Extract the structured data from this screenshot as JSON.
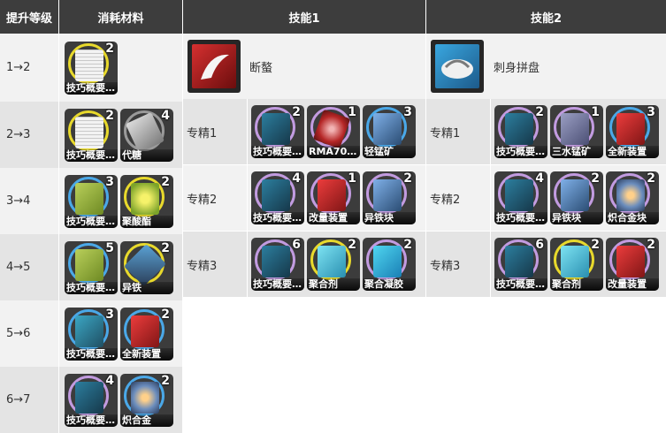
{
  "headers": {
    "level": "提升等级",
    "materials": "消耗材料",
    "skill1": "技能1",
    "skill2": "技能2"
  },
  "upgrade_rows": [
    {
      "level": "1→2",
      "items": [
        {
          "name": "技巧概要…",
          "count": "2",
          "ring": "yellow",
          "art": "paper"
        }
      ]
    },
    {
      "level": "2→3",
      "items": [
        {
          "name": "技巧概要…",
          "count": "2",
          "ring": "yellow",
          "art": "paper"
        },
        {
          "name": "代糖",
          "count": "4",
          "ring": "gray",
          "art": "bar"
        }
      ]
    },
    {
      "level": "3→4",
      "items": [
        {
          "name": "技巧概要…",
          "count": "3",
          "ring": "blue",
          "art": "green"
        },
        {
          "name": "聚酸酯",
          "count": "2",
          "ring": "yellow",
          "art": "resin"
        }
      ]
    },
    {
      "level": "4→5",
      "items": [
        {
          "name": "技巧概要…",
          "count": "5",
          "ring": "blue",
          "art": "green"
        },
        {
          "name": "异铁",
          "count": "2",
          "ring": "yellow",
          "art": "iron"
        }
      ]
    },
    {
      "level": "5→6",
      "items": [
        {
          "name": "技巧概要…",
          "count": "3",
          "ring": "blue",
          "art": "teal"
        },
        {
          "name": "全新装置",
          "count": "2",
          "ring": "blue",
          "art": "red"
        }
      ]
    },
    {
      "level": "6→7",
      "items": [
        {
          "name": "技巧概要…",
          "count": "4",
          "ring": "purple",
          "art": "teal2"
        },
        {
          "name": "炽合金",
          "count": "2",
          "ring": "blue",
          "art": "alloy"
        }
      ]
    }
  ],
  "skill1": {
    "name": "断螯",
    "icon": "crimson-claw-skill-icon",
    "masteries": [
      {
        "label": "专精1",
        "items": [
          {
            "name": "技巧概要…",
            "count": "2",
            "ring": "purple",
            "art": "teal2"
          },
          {
            "name": "RMA70…",
            "count": "1",
            "ring": "purple",
            "art": "gem"
          },
          {
            "name": "轻锰矿",
            "count": "3",
            "ring": "blue",
            "art": "crys"
          }
        ]
      },
      {
        "label": "专精2",
        "items": [
          {
            "name": "技巧概要…",
            "count": "4",
            "ring": "purple",
            "art": "teal2"
          },
          {
            "name": "改量装置",
            "count": "1",
            "ring": "purple",
            "art": "red"
          },
          {
            "name": "异铁块",
            "count": "2",
            "ring": "purple",
            "art": "crys"
          }
        ]
      },
      {
        "label": "专精3",
        "items": [
          {
            "name": "技巧概要…",
            "count": "6",
            "ring": "purple",
            "art": "teal2"
          },
          {
            "name": "聚合剂",
            "count": "2",
            "ring": "yellow",
            "art": "ice"
          },
          {
            "name": "聚合凝胶",
            "count": "2",
            "ring": "purple",
            "art": "gel"
          }
        ]
      }
    ]
  },
  "skill2": {
    "name": "刺身拼盘",
    "icon": "fish-platter-skill-icon",
    "masteries": [
      {
        "label": "专精1",
        "items": [
          {
            "name": "技巧概要…",
            "count": "2",
            "ring": "purple",
            "art": "teal2"
          },
          {
            "name": "三水锰矿",
            "count": "1",
            "ring": "purple",
            "art": "cube"
          },
          {
            "name": "全新装置",
            "count": "3",
            "ring": "blue",
            "art": "red"
          }
        ]
      },
      {
        "label": "专精2",
        "items": [
          {
            "name": "技巧概要…",
            "count": "4",
            "ring": "purple",
            "art": "teal2"
          },
          {
            "name": "异铁块",
            "count": "2",
            "ring": "purple",
            "art": "crys"
          },
          {
            "name": "炽合金块",
            "count": "2",
            "ring": "purple",
            "art": "alloy"
          }
        ]
      },
      {
        "label": "专精3",
        "items": [
          {
            "name": "技巧概要…",
            "count": "6",
            "ring": "purple",
            "art": "teal2"
          },
          {
            "name": "聚合剂",
            "count": "2",
            "ring": "yellow",
            "art": "ice"
          },
          {
            "name": "改量装置",
            "count": "2",
            "ring": "purple",
            "art": "red"
          }
        ]
      }
    ]
  },
  "colors": {
    "header_bg": "#3d3d3d",
    "row_light": "#f2f2f2",
    "row_dark": "#e4e4e4",
    "ring_yellow": "#e8d92c",
    "ring_blue": "#4aa8e8",
    "ring_purple": "#c29be0"
  }
}
